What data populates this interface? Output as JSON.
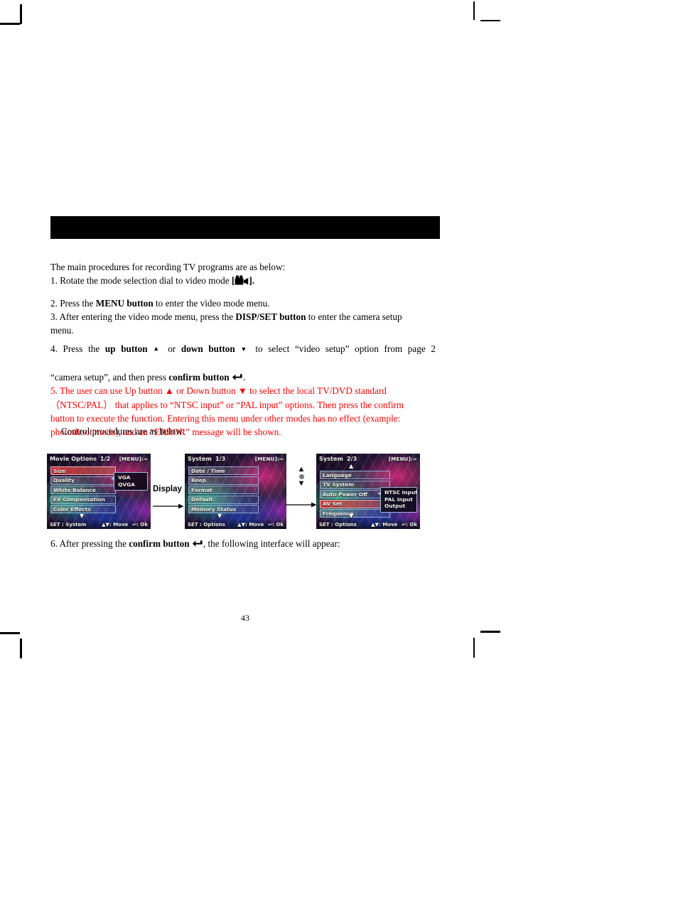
{
  "document": {
    "page_number": "43",
    "header_bar": {
      "label": "",
      "color": "#000000"
    }
  },
  "body": {
    "intro": "The main procedures for recording TV programs are as below:",
    "step1_prefix": "1. Rotate the mode selection dial to video mode",
    "step1_icon": "video-camera-icon",
    "step1_suffix": ".",
    "step2_a": "2. Press the",
    "step2_bold": "MENU button",
    "step2_b": "to enter the video mode menu.",
    "step3_a": "3. After entering the video mode menu, press the",
    "step3_bold": "DISP/SET button",
    "step3_b": "to enter the camera setup",
    "step3_c": "menu.",
    "step4_a": "4. Press the",
    "step4_bold1": "up button",
    "step4_tri_up": "▲",
    "step4_b": "or",
    "step4_bold2": "down button",
    "step4_tri_down": "▼",
    "step4_c": "to select “video setup” option from page 2",
    "step4_d": "“camera setup”, and then press",
    "step4_bold3": "confirm button",
    "step4_icon": "enter-key-icon",
    "step4_e": ".",
    "step5_line1_a": "5. The user can use Up button",
    "step5_tri_up": "▲",
    "step5_line1_b": "or Down button",
    "step5_tri_down": "▼",
    "step5_line1_c": "to select the local TV/DVD standard",
    "step5_line2": "（NTSC/PAL）  that applies to “NTSC input” or “PAL input” options. Then press the confirm",
    "step5_line3": "button to execute the function. Entering this menu under other modes has no effect (example:",
    "step5_line4": "photoshoot mode), and an “ERROR” message will be shown.",
    "step5_color": "#FF0000",
    "control_line": "Control procedures are as below:",
    "step6_a": "6. After pressing the",
    "step6_bold": "confirm button",
    "step6_icon": "enter-key-icon",
    "step6_b": ", the following interface will appear:"
  },
  "figure": {
    "display_label": "Display",
    "screens": [
      {
        "title": "Movie Options",
        "page": "1/2",
        "menu_hint": "[MENU]",
        "items": [
          {
            "label": "Size",
            "selected": true
          },
          {
            "label": "Quality",
            "selected": false
          },
          {
            "label": "White Balance",
            "selected": false
          },
          {
            "label": "EV Compensation",
            "selected": false
          },
          {
            "label": "Color Effects",
            "selected": false
          }
        ],
        "scroll_down": "▼",
        "scroll_up": "",
        "submenu": [
          "VGA",
          "QVGA"
        ],
        "bottom_set": "SET : System",
        "bottom_move": ": Move",
        "bottom_ok": ": Ok"
      },
      {
        "title": "System",
        "page": "1/3",
        "menu_hint": "[MENU]",
        "items": [
          {
            "label": "Date / Time",
            "selected": false
          },
          {
            "label": "Beep",
            "selected": false
          },
          {
            "label": "Format",
            "selected": false
          },
          {
            "label": "Default",
            "selected": false
          },
          {
            "label": "Memory Status",
            "selected": false
          }
        ],
        "scroll_down": "▼",
        "scroll_up": "",
        "submenu": [],
        "bottom_set": "SET : Options",
        "bottom_move": ": Move",
        "bottom_ok": ": Ok"
      },
      {
        "title": "System",
        "page": "2/3",
        "menu_hint": "[MENU]",
        "items": [
          {
            "label": "Language",
            "selected": false
          },
          {
            "label": "TV System",
            "selected": false
          },
          {
            "label": "Auto Power Off",
            "selected": false
          },
          {
            "label": "AV Set",
            "selected": true
          },
          {
            "label": "Frequence",
            "selected": false
          }
        ],
        "scroll_down": "▼",
        "scroll_up": "▲",
        "submenu": [
          "NTSC Input",
          "PAL Input",
          "Output"
        ],
        "bottom_set": "SET : Options",
        "bottom_move": ": Move",
        "bottom_ok": ": Ok"
      }
    ]
  }
}
